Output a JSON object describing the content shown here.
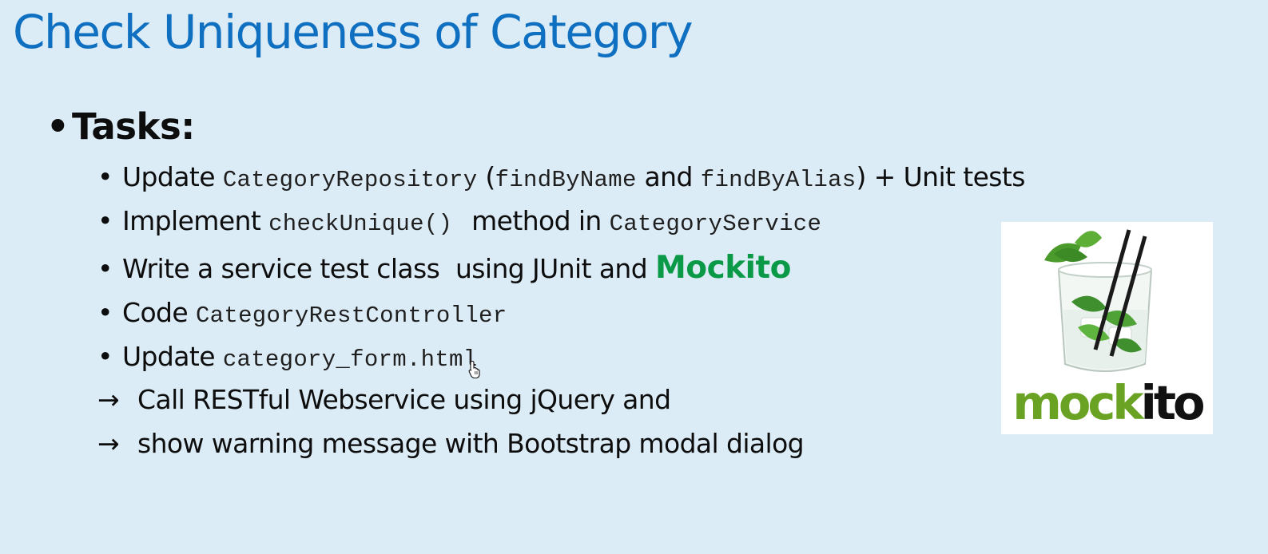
{
  "slide": {
    "title": "Check Uniqueness of Category",
    "heading_bullet": "•",
    "heading": "Tasks:",
    "bullet": "•",
    "arrow": "→",
    "items": [
      {
        "t1": "Update ",
        "code1": "CategoryRepository",
        "t2": " (",
        "code2": "findByName",
        "t3": " and ",
        "code3": "findByAlias",
        "t4": ") + Unit tests"
      },
      {
        "t1": "Implement ",
        "code1": "checkUnique()",
        "t2": " method in ",
        "code2": "CategoryService"
      },
      {
        "t1": "Write a service test class  using JUnit and ",
        "highlight": "Mockito"
      },
      {
        "t1": "Code ",
        "code1": "CategoryRestController"
      },
      {
        "t1": "Update ",
        "code1": "category_form.html"
      }
    ],
    "arrow_lines": [
      "Call RESTful Webservice using jQuery and",
      "show warning message with Bootstrap modal dialog"
    ]
  },
  "logo": {
    "icon": "mojito-glass-icon",
    "word_part1": "mock",
    "word_part2": "ito",
    "colors": {
      "green": "#6aa324",
      "black": "#111111"
    }
  },
  "colors": {
    "background": "#dcecf6",
    "title": "#0f6fc0",
    "highlight": "#0a9a47"
  },
  "cursor": {
    "icon": "hand-pointer-icon"
  }
}
